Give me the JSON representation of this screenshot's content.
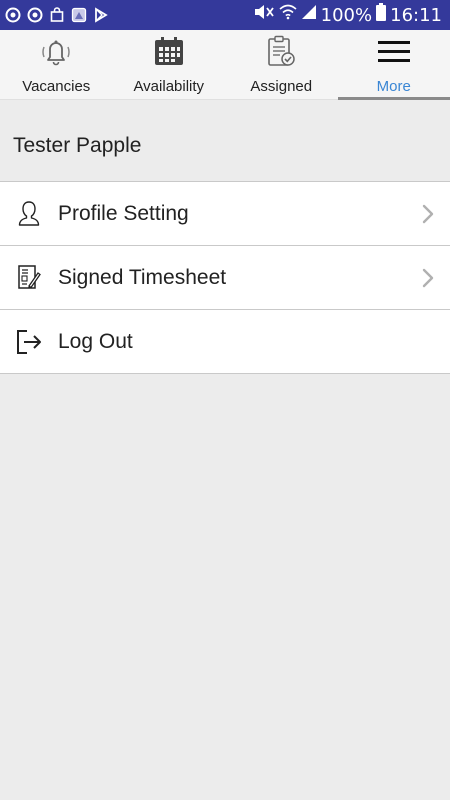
{
  "status_bar": {
    "battery": "100%",
    "time": "16:11"
  },
  "tabs": [
    {
      "label": "Vacancies",
      "icon": "bell-icon",
      "active": false
    },
    {
      "label": "Availability",
      "icon": "calendar-icon",
      "active": false
    },
    {
      "label": "Assigned",
      "icon": "clipboard-check-icon",
      "active": false
    },
    {
      "label": "More",
      "icon": "hamburger-menu-icon",
      "active": true
    }
  ],
  "colors": {
    "status_bar_bg": "#34399b",
    "active_tab_text": "#3a86d4",
    "page_bg": "#ececec"
  },
  "user": {
    "name": "Tester Papple"
  },
  "menu": [
    {
      "label": "Profile Setting",
      "icon": "person-icon",
      "chevron": true
    },
    {
      "label": "Signed Timesheet",
      "icon": "signed-document-icon",
      "chevron": true
    },
    {
      "label": "Log Out",
      "icon": "logout-icon",
      "chevron": false
    }
  ]
}
